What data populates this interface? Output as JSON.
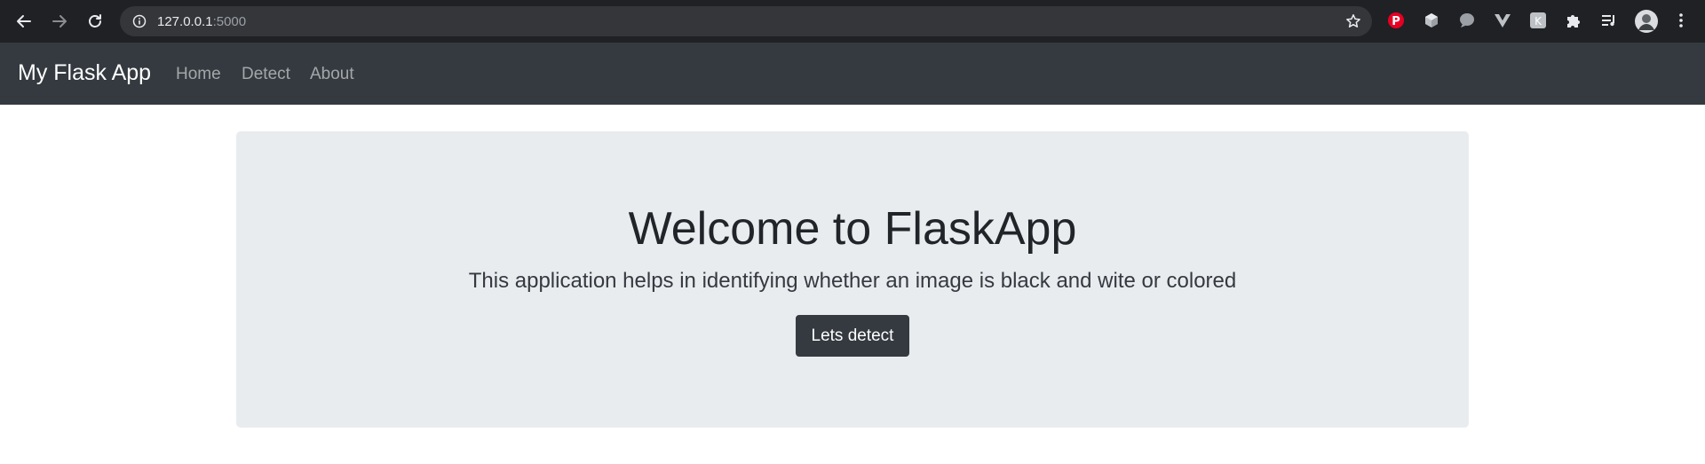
{
  "browser": {
    "url_host": "127.0.0.1",
    "url_port": ":5000",
    "extensions": [
      "pinterest-icon",
      "cube-icon",
      "speech-bubble-icon",
      "vue-icon",
      "k-extension-icon",
      "puzzle-icon",
      "media-queue-icon"
    ],
    "colors": {
      "chrome_bg": "#202124",
      "omnibox_bg": "#35363a",
      "icon": "#e8eaed"
    }
  },
  "navbar": {
    "brand": "My Flask App",
    "links": [
      "Home",
      "Detect",
      "About"
    ],
    "colors": {
      "bg": "#343a40",
      "brand": "#ffffff",
      "link": "rgba(255,255,255,0.55)"
    }
  },
  "jumbotron": {
    "title": "Welcome to FlaskApp",
    "lead": "This application helps in identifying whether an image is black and wite or colored",
    "button_label": "Lets detect",
    "colors": {
      "bg": "#e9ecef",
      "button_bg": "#343a40",
      "button_text": "#ffffff"
    }
  }
}
